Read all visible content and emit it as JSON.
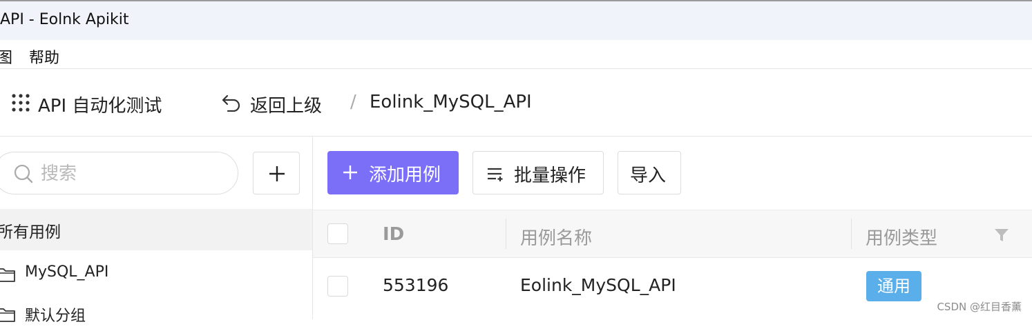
{
  "window": {
    "title": "API - Eolnk Apikit"
  },
  "menu": {
    "items": [
      "图",
      "帮助"
    ]
  },
  "header": {
    "module_label": "API 自动化测试",
    "back_label": "返回上级",
    "separator": "/",
    "breadcrumb": "Eolink_MySQL_API"
  },
  "sidebar": {
    "search_placeholder": "搜索",
    "add_symbol": "+",
    "all_cases_label": "所有用例",
    "groups": [
      {
        "label": "MySQL_API"
      },
      {
        "label": "默认分组"
      }
    ]
  },
  "toolbar": {
    "add_case_label": "添加用例",
    "batch_label": "批量操作",
    "import_label": "导入"
  },
  "table": {
    "columns": [
      "ID",
      "用例名称",
      "用例类型"
    ],
    "rows": [
      {
        "id": "553196",
        "name": "Eolink_MySQL_API",
        "type": "通用"
      }
    ]
  },
  "watermark": "CSDN @红目香薰",
  "colors": {
    "primary": "#7b6ff8",
    "tag": "#5aaeea",
    "titlebar": "#f1f3fa",
    "selected_row": "#f2f2f2"
  },
  "icons": [
    "grid-icon",
    "undo-icon",
    "search-icon",
    "plus-icon",
    "list-icon",
    "folder-icon",
    "filter-icon"
  ]
}
